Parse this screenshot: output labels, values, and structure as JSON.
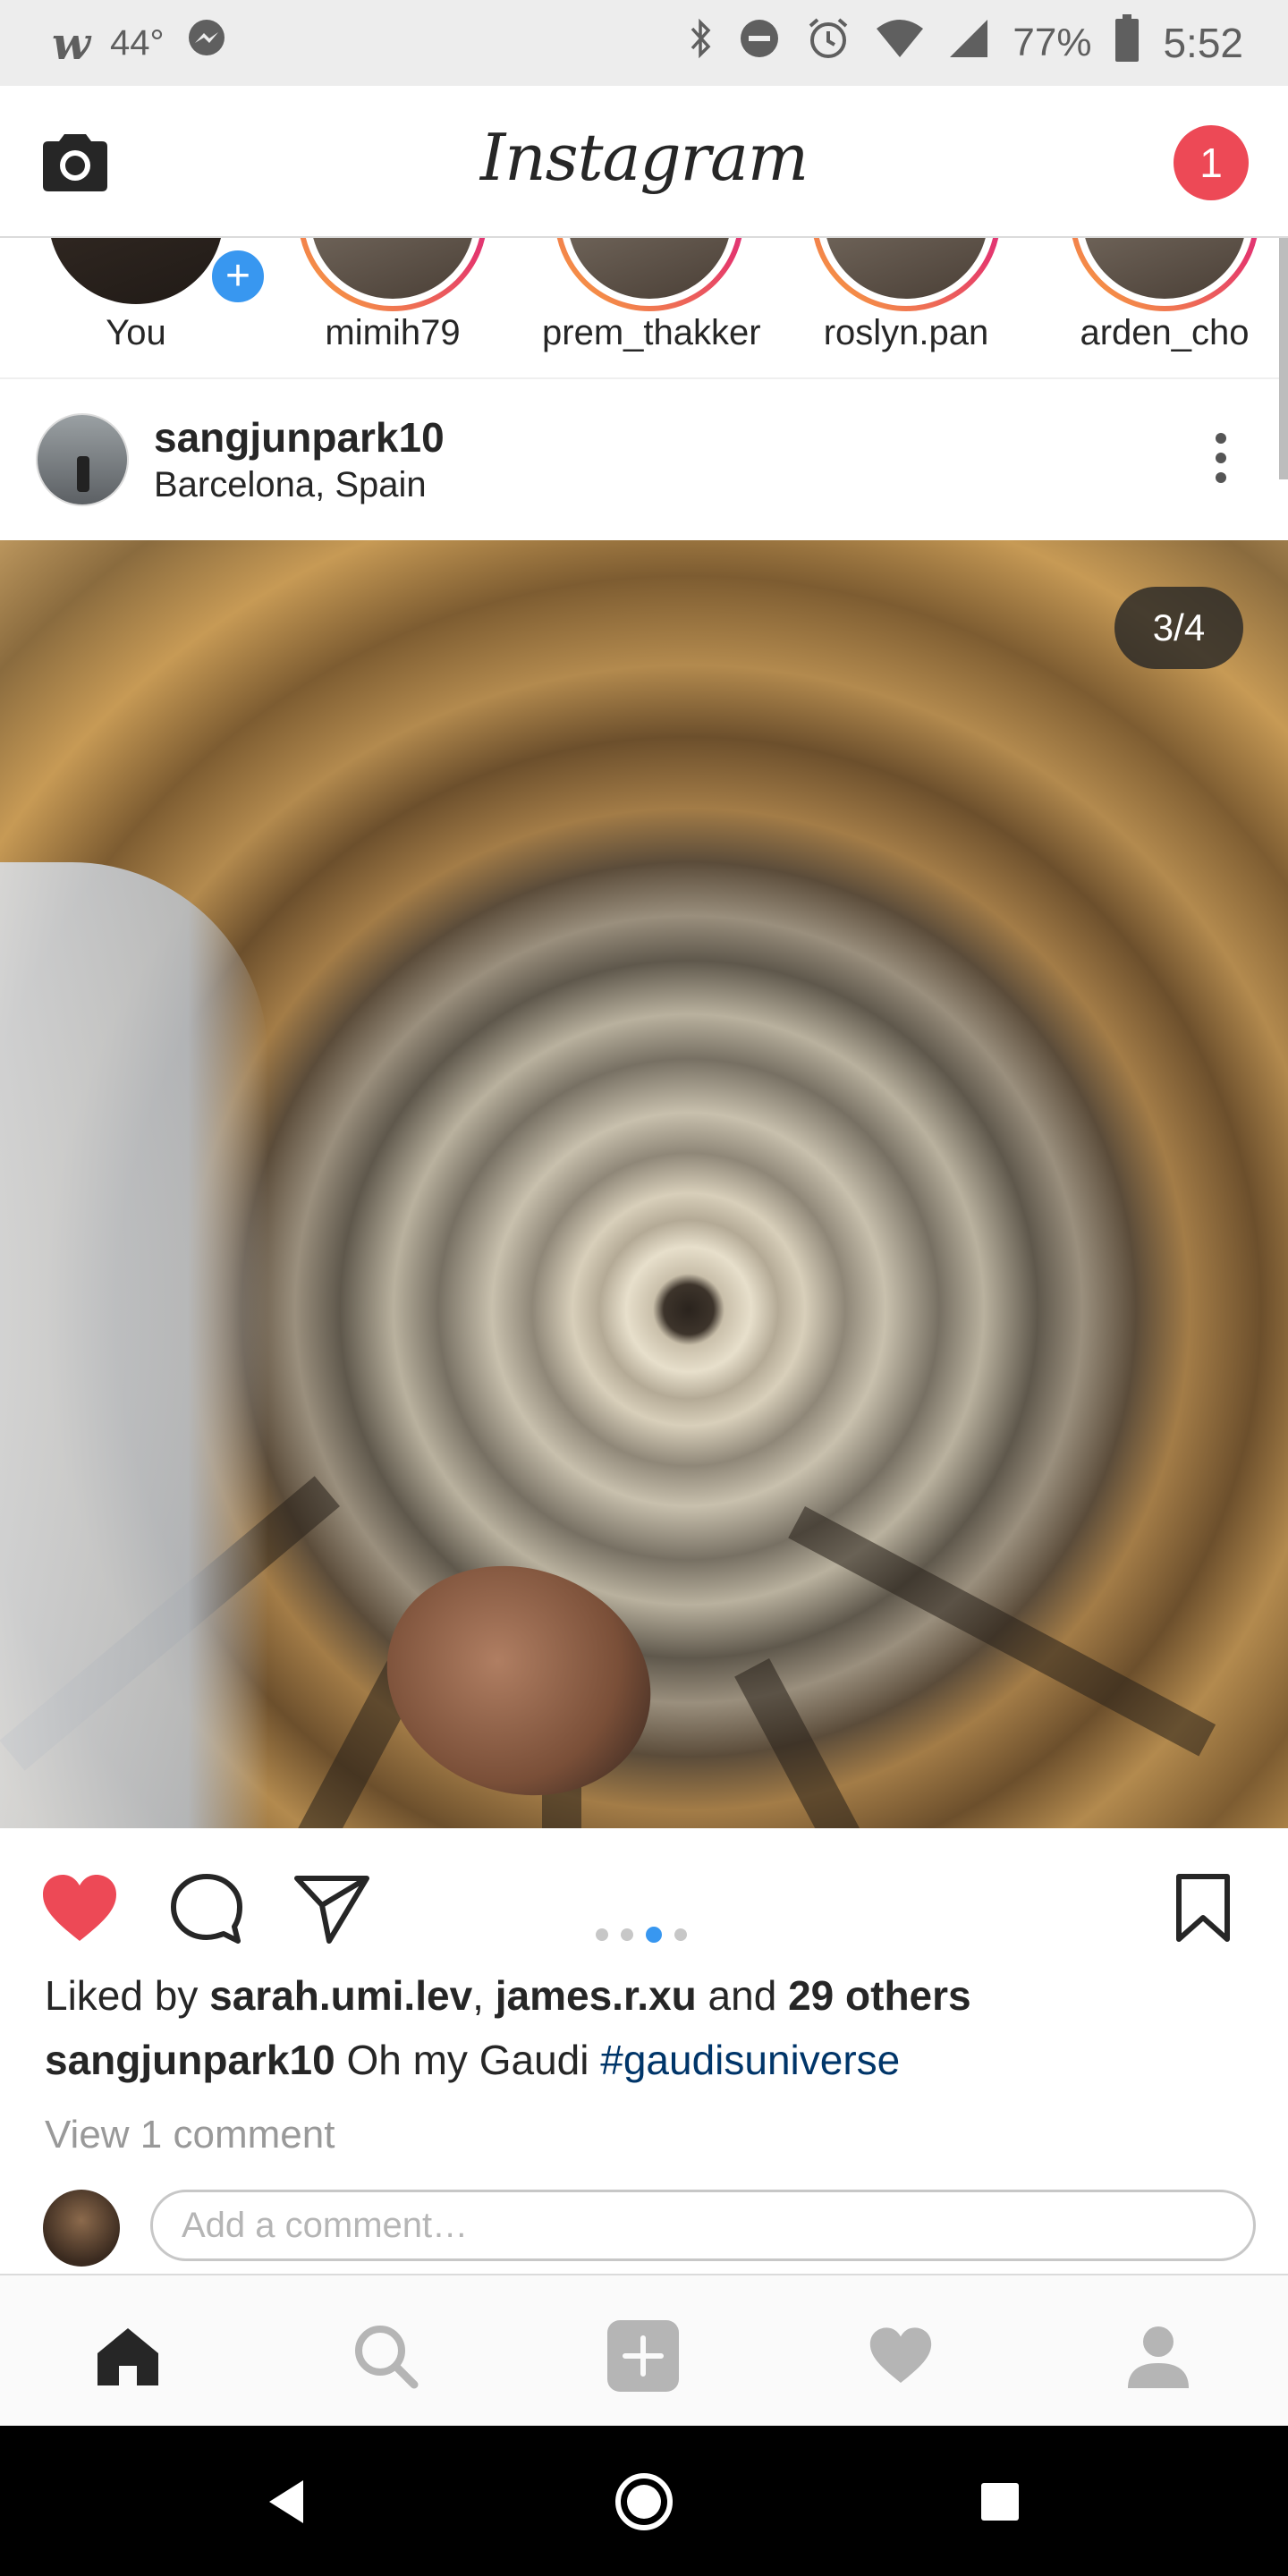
{
  "status_bar": {
    "carrier_icon": "w-logo-icon",
    "temperature": "44°",
    "messenger_icon": "messenger-icon",
    "battery_percent": "77%",
    "time": "5:52",
    "icons": [
      "bluetooth-icon",
      "do-not-disturb-icon",
      "alarm-icon",
      "wifi-icon",
      "signal-icon",
      "battery-icon"
    ]
  },
  "header": {
    "logo": "Instagram",
    "notification_count": "1",
    "camera_icon": "camera-icon"
  },
  "stories": [
    {
      "name": "You",
      "has_add": true
    },
    {
      "name": "mimih79"
    },
    {
      "name": "prem_thakker"
    },
    {
      "name": "roslyn.pan"
    },
    {
      "name": "arden_cho"
    }
  ],
  "post": {
    "username": "sangjunpark10",
    "location": "Barcelona, Spain",
    "counter": "3/4",
    "carousel_total": 4,
    "carousel_active": 3,
    "liked": true,
    "likes": {
      "prefix": "Liked by ",
      "user1": "sarah.umi.lev",
      "separator": ", ",
      "user2": "james.r.xu",
      "middle": " and ",
      "others": "29 others"
    },
    "caption": {
      "username": "sangjunpark10",
      "text": " Oh my Gaudi ",
      "hashtag": "#gaudisuniverse"
    },
    "view_comments": "View 1 comment",
    "comment_placeholder": "Add a comment…"
  },
  "colors": {
    "like_red": "#ed4956",
    "accent_blue": "#3897f0",
    "hashtag_blue": "#003569",
    "muted_gray": "#999999"
  },
  "bottom_nav": [
    "home-icon",
    "search-icon",
    "add-post-icon",
    "activity-heart-icon",
    "profile-icon"
  ],
  "system_nav": [
    "back-icon",
    "home-circle-icon",
    "recents-icon"
  ]
}
